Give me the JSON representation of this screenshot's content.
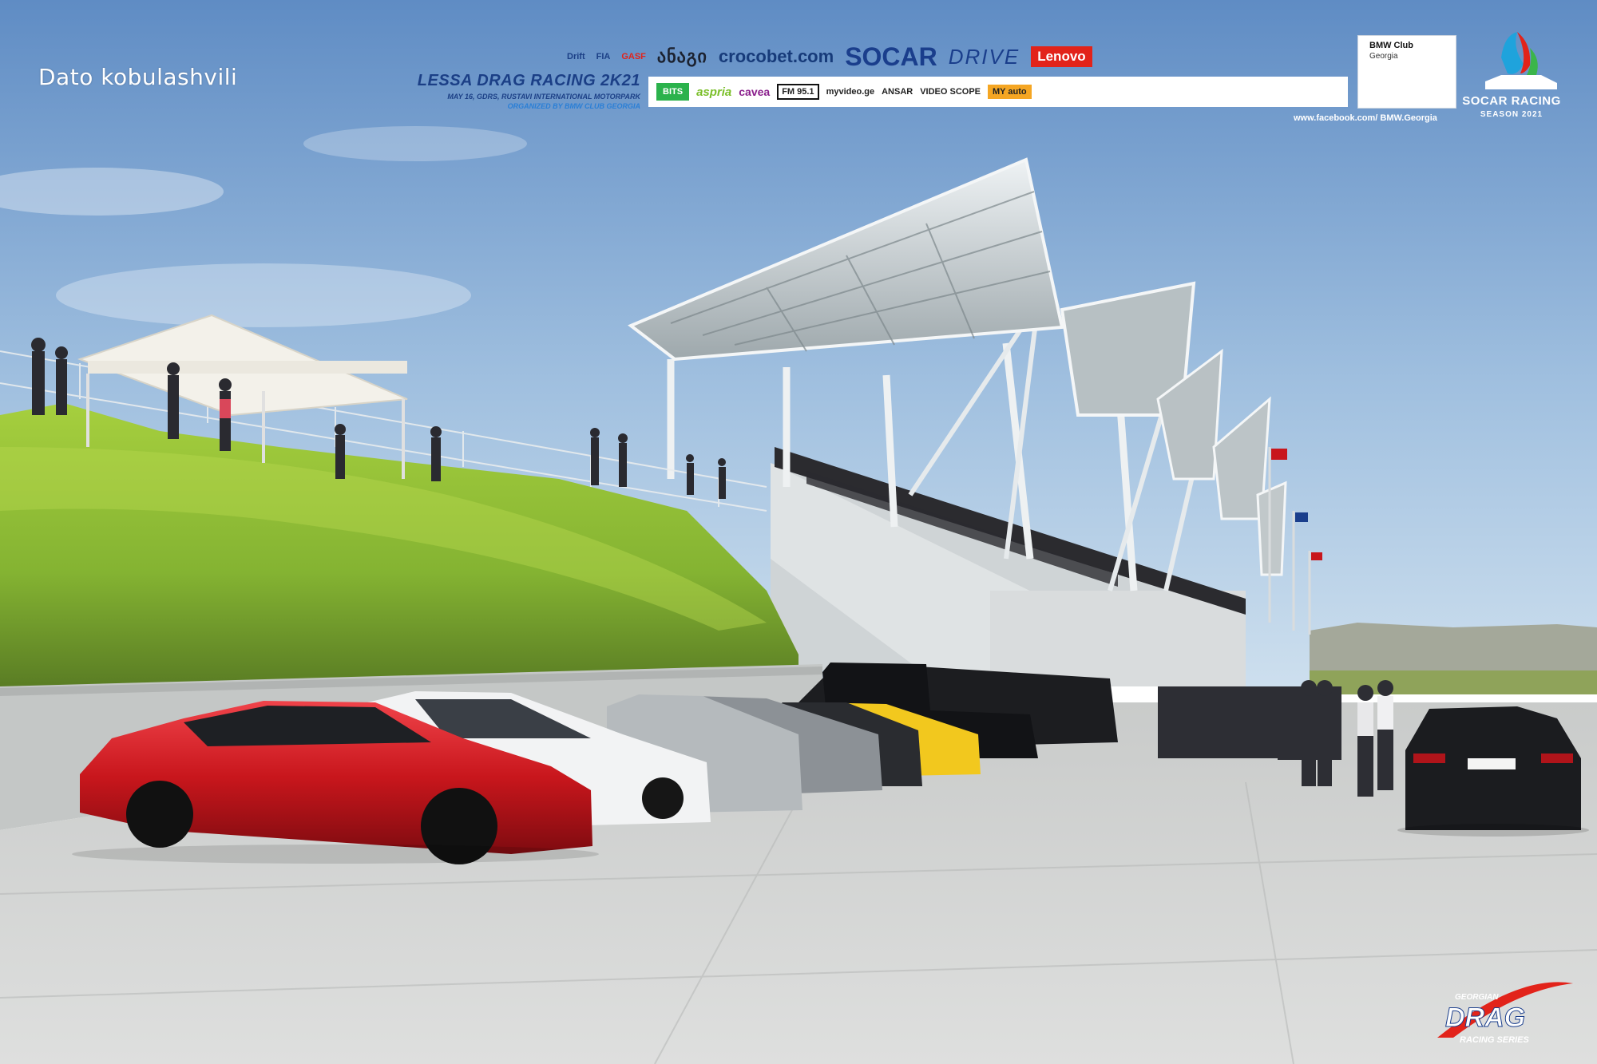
{
  "photo_credit": "Dato kobulashvili",
  "event": {
    "title": "LESSA DRAG RACING 2K21",
    "subtitle": "MAY 16, GDRS, RUSTAVI INTERNATIONAL MOTORPARK",
    "organizer": "ORGANIZED BY BMW CLUB GEORGIA"
  },
  "sponsors_top": [
    "Drift",
    "FIA",
    "GASF",
    "ანაგი",
    "crocobet.com",
    "SOCAR",
    "DRIVE",
    "Lenovo"
  ],
  "sponsors_bottom": [
    "BITS",
    "aspria",
    "cavea",
    "FM 95.1",
    "myvideo.ge",
    "ANSAR",
    "VIDEO SCOPE",
    "MY auto"
  ],
  "bmw_club": {
    "name": "BMW Club",
    "country": "Georgia",
    "url": "www.facebook.com/ BMW.Georgia"
  },
  "socar_racing": {
    "name": "SOCAR RACING",
    "season": "SEASON 2021"
  },
  "gdrs_logo": {
    "top": "GEORGIAN",
    "main": "DRAG",
    "bottom": "RACING SERIES"
  },
  "scene": {
    "subject": "car show parking lot beside racetrack grandstand",
    "colors": {
      "sky_top": "#6a94c8",
      "sky_bottom": "#c6daec",
      "grass": "#8cbc36",
      "concrete": "#d6d8d6",
      "brand_blue": "#1a3e8c",
      "red_car": "#c8161c"
    }
  }
}
